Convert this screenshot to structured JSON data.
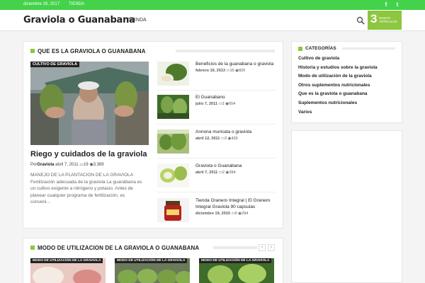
{
  "topbar": {
    "date": "diciembre 26, 2017",
    "tienda": "TIENDA",
    "social": [
      {
        "icon": "facebook-icon",
        "glyph": "f"
      },
      {
        "icon": "twitter-icon",
        "glyph": "t"
      }
    ]
  },
  "header": {
    "logo": "Graviola o Guanabana",
    "nav_tienda": "TIENDA",
    "cart": {
      "count": "3",
      "label": "nuevo artículos"
    }
  },
  "colors": {
    "topbar": "#44d24a",
    "accent": "#8dc63f",
    "badge": "#222222"
  },
  "main": {
    "section_title": "QUE ES LA GRAVIOLA O GUANABANA",
    "featured": {
      "badge": "CULTIVO DE GRAVIOLA",
      "title": "Riego y cuidados de la graviola",
      "author_prefix": "Por",
      "author": "Graviola",
      "date": "abril 7, 2011",
      "comments": "19",
      "views": "3,389",
      "excerpt": "MANEJO DE LA PLANTACION DE LA GRAVIOLA Fertilización adecuada de la graviola La guanábana es un cultivo exigente a nitrógeno y potasio. Antes de planear cualquier programa de fertilización, es conveni…"
    },
    "items": [
      {
        "title": "Beneficios de la guanabana o graviola",
        "date": "febrero 19, 2013",
        "comments": "15",
        "views": "825"
      },
      {
        "title": "El Guanabano",
        "date": "julio 7, 2011",
        "comments": "2",
        "views": "654"
      },
      {
        "title": "Annona muricata o graviola",
        "date": "abril 12, 2011",
        "comments": "3",
        "views": "433"
      },
      {
        "title": "Graviola o Guanabana",
        "date": "abril 7, 2011",
        "comments": "2",
        "views": "394"
      },
      {
        "title": "Tienda Granero Integral | El Granero Integral Graviola 90 capsulas",
        "date": "diciembre 19, 2015",
        "comments": "0",
        "views": "294"
      }
    ]
  },
  "sidebar": {
    "title": "CATEGORÍAS",
    "categories": [
      "Cultivo de graviola",
      "Historia y estudios sobre la graviola",
      "Modo de utilización de la graviola",
      "Otros suplementos nutricionales",
      "Que es la graviola o guanabana",
      "Suplementos nutricionales",
      "Varios"
    ]
  },
  "second": {
    "section_title": "MODO DE UTILIZACION DE LA GRAVIOLA O GUANABANA",
    "prev": "‹",
    "next": "›",
    "badges": [
      "MODO DE UTILIZACIÓN DE LA GRAVIOLA",
      "MODO DE UTILIZACIÓN DE LA GRAVIOLA",
      "MODO DE UTILIZACIÓN DE LA GRAVIOLA"
    ]
  }
}
